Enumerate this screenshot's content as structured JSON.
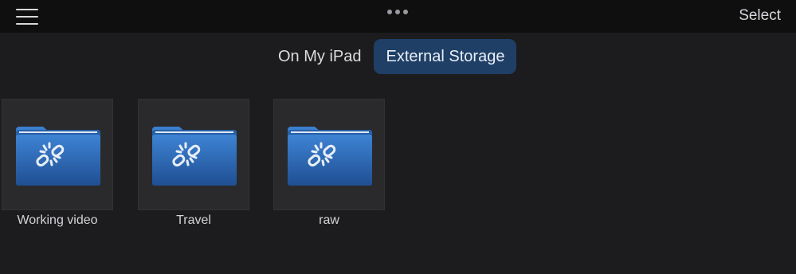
{
  "header": {
    "menu_icon": "hamburger-menu-icon",
    "more_icon": "more-dots-icon",
    "select_label": "Select"
  },
  "segments": [
    {
      "label": "On My iPad",
      "active": false
    },
    {
      "label": "External Storage",
      "active": true
    }
  ],
  "folders": [
    {
      "name": "Working video",
      "icon": "broken-link-folder-icon"
    },
    {
      "name": "Travel",
      "icon": "broken-link-folder-icon"
    },
    {
      "name": "raw",
      "icon": "broken-link-folder-icon"
    }
  ],
  "colors": {
    "background": "#1c1c1e",
    "topbar": "#0f0f10",
    "active_segment": "#1f3f66",
    "folder_blue": "#2f6db5"
  }
}
